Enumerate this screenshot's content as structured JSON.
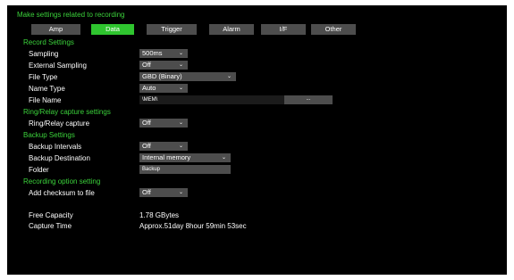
{
  "header": {
    "title": "Make settings related to recording"
  },
  "tabs": [
    {
      "label": "Amp",
      "active": false
    },
    {
      "label": "Data",
      "active": true
    },
    {
      "label": "Trigger",
      "active": false
    },
    {
      "label": "Alarm",
      "active": false
    },
    {
      "label": "I/F",
      "active": false
    },
    {
      "label": "Other",
      "active": false
    }
  ],
  "record_settings": {
    "heading": "Record Settings",
    "sampling": {
      "label": "Sampling",
      "value": "500ms"
    },
    "external_sampling": {
      "label": "External Sampling",
      "value": "Off"
    },
    "file_type": {
      "label": "File Type",
      "value": "GBD (Binary)"
    },
    "name_type": {
      "label": "Name Type",
      "value": "Auto"
    },
    "file_name": {
      "label": "File Name",
      "value": "\\MEM\\",
      "browse_label": "..."
    }
  },
  "ring_relay": {
    "heading": "Ring/Relay capture   settings",
    "capture": {
      "label": "Ring/Relay capture",
      "value": "Off"
    }
  },
  "backup_settings": {
    "heading": "Backup Settings",
    "intervals": {
      "label": "Backup Intervals",
      "value": "Off"
    },
    "destination": {
      "label": "Backup Destination",
      "value": "Internal memory"
    },
    "folder": {
      "label": "Folder",
      "value": "Backup"
    }
  },
  "recording_option": {
    "heading": "Recording option setting",
    "checksum": {
      "label": "Add checksum to file",
      "value": "Off"
    }
  },
  "status": {
    "free_capacity_label": "Free Capacity",
    "free_capacity_value": "1.78 GBytes",
    "capture_time_label": "Capture Time",
    "capture_time_value": "Approx.51day 8hour 59min 53sec"
  },
  "colors": {
    "background": "#000000",
    "accent_green": "#3bd23b",
    "active_tab": "#2fc52f",
    "control_grey": "#4d4d4d"
  },
  "icons": {
    "dropdown": "chevron-down-icon"
  }
}
